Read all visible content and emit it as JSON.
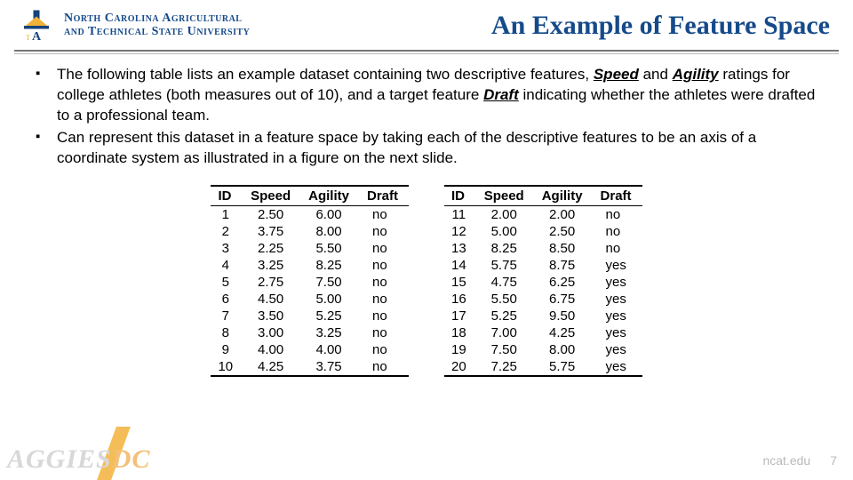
{
  "header": {
    "university_line1": "North Carolina Agricultural",
    "university_line2": "and Technical State University",
    "slide_title": "An Example of Feature Space"
  },
  "bullets": {
    "b1_pre": "The following table lists an example dataset containing two descriptive features, ",
    "kw_speed": "Speed",
    "b1_mid": " and ",
    "kw_agility": "Agility",
    "b1_mid2": " ratings for college athletes (both measures out of 10), and a target feature ",
    "kw_draft": "Draft",
    "b1_post": " indicating whether the athletes were drafted to a professional team.",
    "b2": "Can represent this dataset in a feature space by taking each of the descriptive features to be an axis of a coordinate system as illustrated in a figure on the next slide."
  },
  "table_head": {
    "id": "ID",
    "speed": "Speed",
    "agility": "Agility",
    "draft": "Draft"
  },
  "rows_left": [
    {
      "id": "1",
      "speed": "2.50",
      "agility": "6.00",
      "draft": "no"
    },
    {
      "id": "2",
      "speed": "3.75",
      "agility": "8.00",
      "draft": "no"
    },
    {
      "id": "3",
      "speed": "2.25",
      "agility": "5.50",
      "draft": "no"
    },
    {
      "id": "4",
      "speed": "3.25",
      "agility": "8.25",
      "draft": "no"
    },
    {
      "id": "5",
      "speed": "2.75",
      "agility": "7.50",
      "draft": "no"
    },
    {
      "id": "6",
      "speed": "4.50",
      "agility": "5.00",
      "draft": "no"
    },
    {
      "id": "7",
      "speed": "3.50",
      "agility": "5.25",
      "draft": "no"
    },
    {
      "id": "8",
      "speed": "3.00",
      "agility": "3.25",
      "draft": "no"
    },
    {
      "id": "9",
      "speed": "4.00",
      "agility": "4.00",
      "draft": "no"
    },
    {
      "id": "10",
      "speed": "4.25",
      "agility": "3.75",
      "draft": "no"
    }
  ],
  "rows_right": [
    {
      "id": "11",
      "speed": "2.00",
      "agility": "2.00",
      "draft": "no"
    },
    {
      "id": "12",
      "speed": "5.00",
      "agility": "2.50",
      "draft": "no"
    },
    {
      "id": "13",
      "speed": "8.25",
      "agility": "8.50",
      "draft": "no"
    },
    {
      "id": "14",
      "speed": "5.75",
      "agility": "8.75",
      "draft": "yes"
    },
    {
      "id": "15",
      "speed": "4.75",
      "agility": "6.25",
      "draft": "yes"
    },
    {
      "id": "16",
      "speed": "5.50",
      "agility": "6.75",
      "draft": "yes"
    },
    {
      "id": "17",
      "speed": "5.25",
      "agility": "9.50",
      "draft": "yes"
    },
    {
      "id": "18",
      "speed": "7.00",
      "agility": "4.25",
      "draft": "yes"
    },
    {
      "id": "19",
      "speed": "7.50",
      "agility": "8.00",
      "draft": "yes"
    },
    {
      "id": "20",
      "speed": "7.25",
      "agility": "5.75",
      "draft": "yes"
    }
  ],
  "footer": {
    "site": "ncat.edu",
    "page": "7",
    "watermark_a": "AGGIES",
    "watermark_b": "DC"
  }
}
